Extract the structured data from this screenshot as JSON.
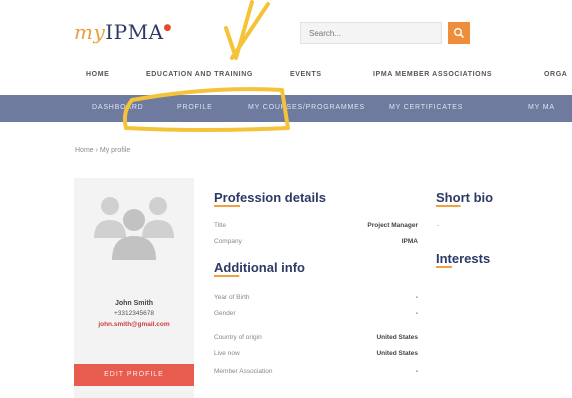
{
  "header": {
    "logo_prefix": "my",
    "logo_main": "IPMA",
    "logo_mark": "●",
    "search_placeholder": "Search..."
  },
  "main_nav": [
    "HOME",
    "EDUCATION AND TRAINING",
    "EVENTS",
    "IPMA MEMBER ASSOCIATIONS",
    "ORGA"
  ],
  "sub_nav": [
    "DASHBOARD",
    "PROFILE",
    "MY COURSES/PROGRAMMES",
    "MY CERTIFICATES",
    "MY MA"
  ],
  "breadcrumb": "Home › My profile",
  "user": {
    "name": "John Smith",
    "phone": "+3312345678",
    "email": "john.smith@gmail.com",
    "edit_label": "EDIT PROFILE"
  },
  "profession": {
    "heading_u": "Prof",
    "heading_rest": "ession details",
    "fields": [
      {
        "label": "Title",
        "value": "Project Manager"
      },
      {
        "label": "Company",
        "value": "IPMA"
      }
    ]
  },
  "additional": {
    "heading_u": "Add",
    "heading_rest": "itional info",
    "fields": [
      {
        "label": "Year of Birth",
        "value": "-"
      },
      {
        "label": "Gender",
        "value": "-"
      },
      {
        "label": "Country of origin",
        "value": "United States"
      },
      {
        "label": "Live now",
        "value": "United States"
      },
      {
        "label": "Member Association",
        "value": "-"
      }
    ]
  },
  "short_bio": {
    "heading_u": "Sho",
    "heading_rest": "rt bio",
    "value": "-"
  },
  "interests": {
    "heading_u": "Int",
    "heading_rest": "erests"
  },
  "colors": {
    "brand_navy": "#2e3a66",
    "accent_orange": "#ef8e3a",
    "subnav_bg": "#6e7b9e",
    "edit_button": "#e85c4f",
    "annotation": "#f5c33a"
  }
}
